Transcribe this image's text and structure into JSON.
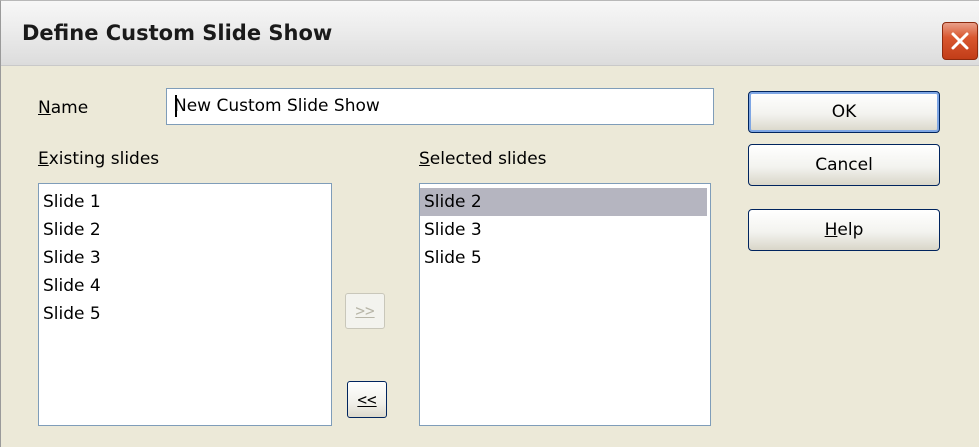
{
  "dialog": {
    "title": "Define Custom Slide Show"
  },
  "name_field": {
    "label": "Name",
    "value": "New Custom Slide Show"
  },
  "existing_slides": {
    "label": "Existing slides",
    "items": [
      "Slide 1",
      "Slide 2",
      "Slide 3",
      "Slide 4",
      "Slide 5"
    ]
  },
  "selected_slides": {
    "label": "Selected slides",
    "items": [
      "Slide 2",
      "Slide 3",
      "Slide 5"
    ],
    "selected_item": "Slide 2"
  },
  "buttons": {
    "add": ">>",
    "remove": "<<",
    "ok": "OK",
    "cancel": "Cancel",
    "help": "Help"
  },
  "colors": {
    "selection": "#b5b5c0",
    "close_button": "#d9572f"
  },
  "icons": {
    "close": "close-x-icon"
  }
}
